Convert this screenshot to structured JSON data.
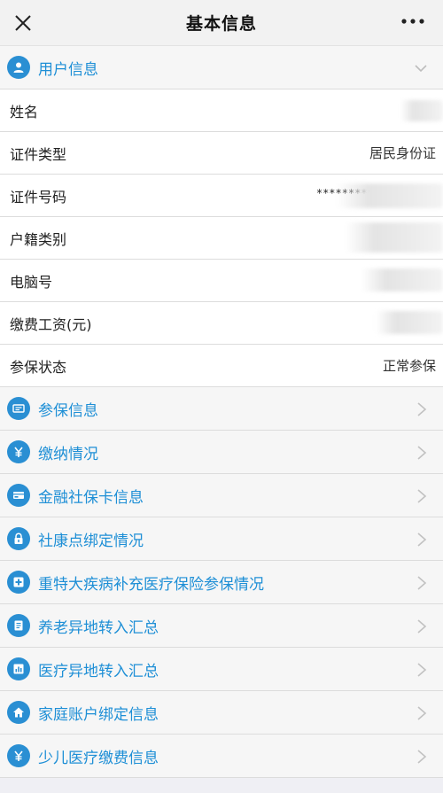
{
  "header": {
    "title": "基本信息",
    "close_icon": "close-icon",
    "more_icon": "more-icon"
  },
  "user_section": {
    "label": "用户信息",
    "icon": "user-icon",
    "expanded": true
  },
  "fields": [
    {
      "key": "name",
      "label": "姓名",
      "value": "",
      "masked": true
    },
    {
      "key": "id_type",
      "label": "证件类型",
      "value": "居民身份证",
      "masked": false
    },
    {
      "key": "id_number",
      "label": "证件号码",
      "value": "**************",
      "masked": true
    },
    {
      "key": "household_type",
      "label": "户籍类别",
      "value": "",
      "masked": true
    },
    {
      "key": "computer_no",
      "label": "电脑号",
      "value": "",
      "masked": true
    },
    {
      "key": "salary",
      "label": "缴费工资(元)",
      "value": "",
      "masked": true
    },
    {
      "key": "insurance_status",
      "label": "参保状态",
      "value": "正常参保",
      "masked": false
    }
  ],
  "links": [
    {
      "label": "参保信息",
      "icon": "id-card-icon"
    },
    {
      "label": "缴纳情况",
      "icon": "yuan-icon"
    },
    {
      "label": "金融社保卡信息",
      "icon": "card-icon"
    },
    {
      "label": "社康点绑定情况",
      "icon": "lock-icon"
    },
    {
      "label": "重特大疾病补充医疗保险参保情况",
      "icon": "medical-cross-icon"
    },
    {
      "label": "养老异地转入汇总",
      "icon": "document-icon"
    },
    {
      "label": "医疗异地转入汇总",
      "icon": "chart-icon"
    },
    {
      "label": "家庭账户绑定信息",
      "icon": "home-icon"
    },
    {
      "label": "少儿医疗缴费信息",
      "icon": "yuan-icon"
    }
  ],
  "colors": {
    "accent": "#1e8fd6",
    "icon_bg": "#2a8fd3",
    "header_bg": "#f2f2f2",
    "row_bg": "#ffffff"
  }
}
